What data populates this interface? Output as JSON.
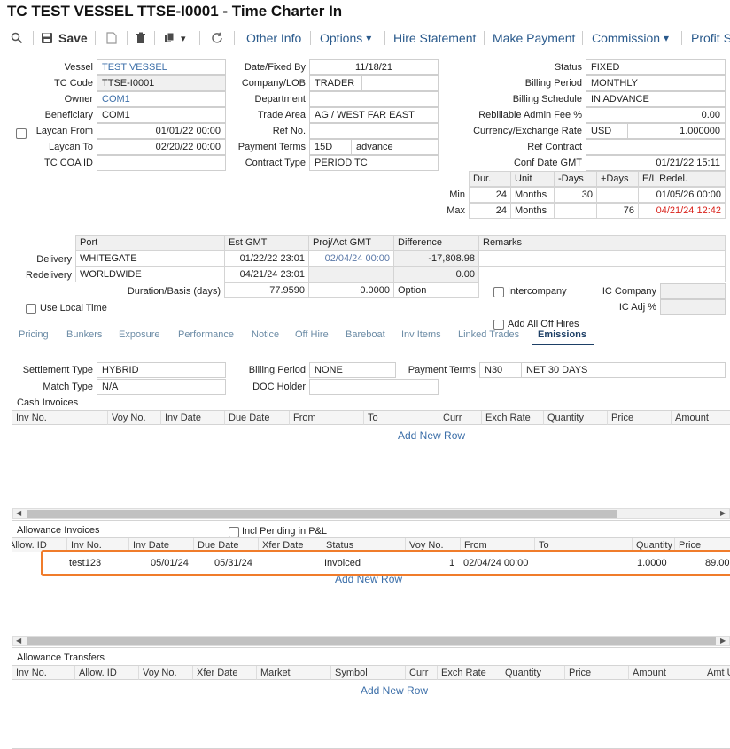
{
  "title": "TC TEST VESSEL TTSE-I0001 - Time Charter In",
  "toolbar": {
    "save": "Save",
    "other_info": "Other Info",
    "options": "Options",
    "hire_statement": "Hire Statement",
    "make_payment": "Make Payment",
    "commission": "Commission",
    "profit": "Profit S"
  },
  "caret": "▾",
  "form": {
    "vessel_label": "Vessel",
    "vessel": "TEST VESSEL",
    "tc_code_label": "TC Code",
    "tc_code": "TTSE-I0001",
    "owner_label": "Owner",
    "owner": "COM1",
    "beneficiary_label": "Beneficiary",
    "beneficiary": "COM1",
    "laycan_from_label": "Laycan From",
    "laycan_from": "01/01/22 00:00",
    "laycan_to_label": "Laycan To",
    "laycan_to": "02/20/22 00:00",
    "tc_coa_label": "TC COA ID",
    "tc_coa": "",
    "date_fixed_label": "Date/Fixed By",
    "date_fixed": "11/18/21",
    "company_label": "Company/LOB",
    "company": "TRADER",
    "department_label": "Department",
    "trade_area_label": "Trade Area",
    "trade_area": "AG / WEST FAR EAST",
    "ref_no_label": "Ref No.",
    "payment_terms_label": "Payment Terms",
    "payment_terms_code": "15D",
    "payment_terms": "advance",
    "contract_type_label": "Contract Type",
    "contract_type": "PERIOD TC",
    "status_label": "Status",
    "status": "FIXED",
    "billing_period_label": "Billing Period",
    "billing_period": "MONTHLY",
    "billing_schedule_label": "Billing Schedule",
    "billing_schedule": "IN ADVANCE",
    "admin_fee_label": "Rebillable Admin Fee %",
    "admin_fee": "0.00",
    "currency_label": "Currency/Exchange Rate",
    "currency": "USD",
    "exchange_rate": "1.000000",
    "ref_contract_label": "Ref Contract",
    "conf_date_label": "Conf Date GMT",
    "conf_date": "01/21/22 15:11"
  },
  "duration": {
    "headers": [
      "Dur.",
      "Unit",
      "-Days",
      "+Days",
      "E/L Redel."
    ],
    "min_label": "Min",
    "max_label": "Max",
    "min": [
      "24",
      "Months",
      "30",
      "",
      "01/05/26 00:00"
    ],
    "max": [
      "24",
      "Months",
      "",
      "76",
      "04/21/24 12:42"
    ]
  },
  "ports": {
    "headers": [
      "Port",
      "Est GMT",
      "Proj/Act GMT",
      "Difference",
      "Remarks"
    ],
    "delivery_label": "Delivery",
    "delivery": [
      "WHITEGATE",
      "01/22/22 23:01",
      "02/04/24 00:00",
      "-17,808.98",
      ""
    ],
    "redelivery_label": "Redelivery",
    "redelivery": [
      "WORLDWIDE",
      "04/21/24 23:01",
      "",
      "0.00",
      ""
    ],
    "duration_label": "Duration/Basis (days)",
    "duration_days": "77.9590",
    "duration_basis": "0.0000",
    "option": "Option",
    "intercompany": "Intercompany",
    "ic_company_label": "IC Company",
    "ic_adj_label": "IC Adj %",
    "use_local_time": "Use Local Time",
    "add_all_off_hires": "Add All Off Hires"
  },
  "tabs": [
    "Pricing",
    "Bunkers",
    "Exposure",
    "Performance",
    "Notice",
    "Off Hire",
    "Bareboat",
    "Inv Items",
    "Linked Trades",
    "Emissions"
  ],
  "emissions": {
    "settlement_type_label": "Settlement Type",
    "settlement_type": "HYBRID",
    "match_type_label": "Match Type",
    "match_type": "N/A",
    "billing_period_label": "Billing Period",
    "billing_period": "NONE",
    "doc_holder_label": "DOC Holder",
    "doc_holder": "",
    "payment_terms_label": "Payment Terms",
    "payment_terms_code": "N30",
    "payment_terms": "NET 30 DAYS"
  },
  "cash_invoices": {
    "title": "Cash Invoices",
    "headers": [
      "Inv No.",
      "Voy No.",
      "Inv Date",
      "Due Date",
      "From",
      "To",
      "Curr",
      "Exch Rate",
      "Quantity",
      "Price",
      "Amount"
    ],
    "add_row": "Add New Row"
  },
  "allowance_invoices": {
    "title": "Allowance Invoices",
    "incl_pending": "Incl Pending in P&L",
    "headers": [
      "Allow. ID",
      "Inv No.",
      "Inv Date",
      "Due Date",
      "Xfer Date",
      "Status",
      "Voy No.",
      "From",
      "To",
      "Quantity",
      "Price"
    ],
    "row": {
      "inv_no": "test123",
      "inv_date": "05/01/24",
      "due_date": "05/31/24",
      "status": "Invoiced",
      "voy_no": "1",
      "from": "02/04/24 00:00",
      "quantity": "1.0000",
      "price": "89.00"
    },
    "add_row": "Add New Row"
  },
  "allowance_transfers": {
    "title": "Allowance Transfers",
    "headers": [
      "Inv No.",
      "Allow. ID",
      "Voy No.",
      "Xfer Date",
      "Market",
      "Symbol",
      "Curr",
      "Exch Rate",
      "Quantity",
      "Price",
      "Amount",
      "Amt U"
    ],
    "add_row": "Add New Row"
  }
}
